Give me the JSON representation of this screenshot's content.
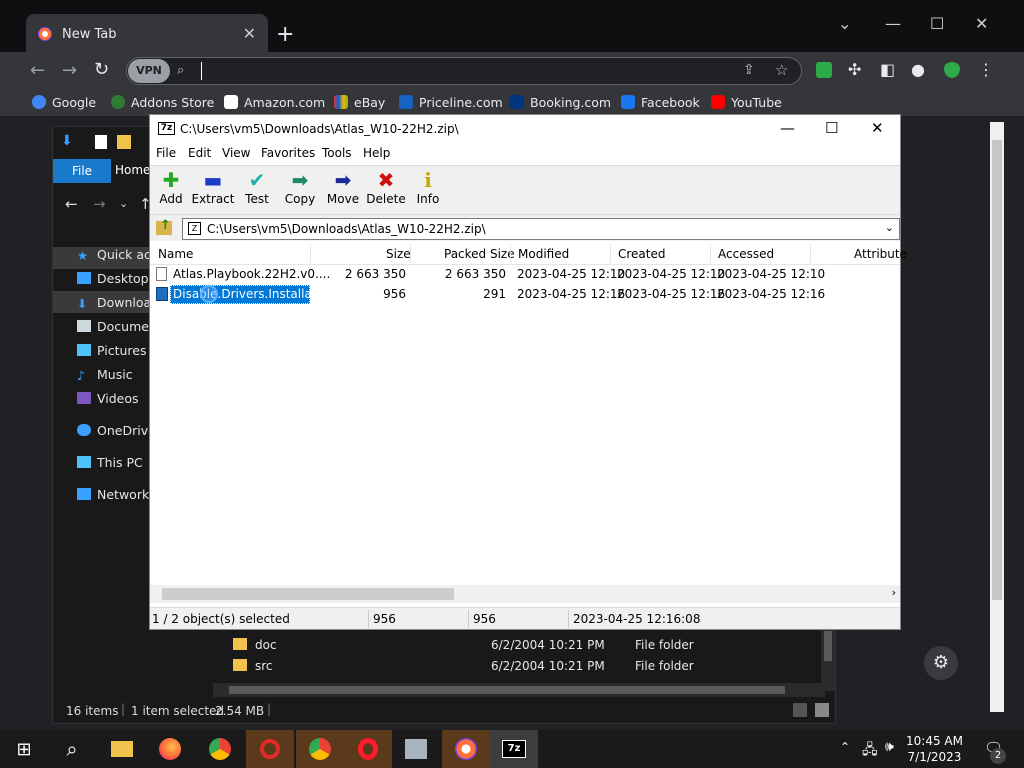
{
  "browser": {
    "tab_title": "New Tab",
    "vpn_label": "VPN",
    "address_value": "",
    "bookmarks": [
      {
        "label": "Google",
        "color": "#4285f4"
      },
      {
        "label": "Addons Store",
        "color": "#2e7d32"
      },
      {
        "label": "Amazon.com",
        "color": "#ffffff"
      },
      {
        "label": "eBay",
        "color": "#e53238"
      },
      {
        "label": "Priceline.com",
        "color": "#1565c0"
      },
      {
        "label": "Booking.com",
        "color": "#003580"
      },
      {
        "label": "Facebook",
        "color": "#1877f2"
      },
      {
        "label": "YouTube",
        "color": "#ff0000"
      }
    ]
  },
  "explorer": {
    "ribbon_file": "File",
    "ribbon_home": "Home",
    "nav": [
      "Quick access",
      "Desktop",
      "Downloads",
      "Documents",
      "Pictures",
      "Music",
      "Videos",
      "OneDrive",
      "This PC",
      "Network"
    ],
    "nav_display": [
      "Quick acc",
      "Desktop",
      "Downloa",
      "Docume",
      "Pictures",
      "Music",
      "Videos",
      "OneDrive",
      "This PC",
      "Network"
    ],
    "rows": [
      {
        "name": "doc",
        "date": "6/2/2004 10:21 PM",
        "type": "File folder"
      },
      {
        "name": "src",
        "date": "6/2/2004 10:21 PM",
        "type": "File folder"
      }
    ],
    "status_items": "16 items",
    "status_selected": "1 item selected",
    "status_size": "2.54 MB"
  },
  "sevenzip": {
    "title": "C:\\Users\\vm5\\Downloads\\Atlas_W10-22H2.zip\\",
    "menu": [
      "File",
      "Edit",
      "View",
      "Favorites",
      "Tools",
      "Help"
    ],
    "tools": [
      {
        "label": "Add",
        "icon": "plus-icon",
        "glyph": "✚",
        "color": "#22aa22"
      },
      {
        "label": "Extract",
        "icon": "minus-icon",
        "glyph": "▬",
        "color": "#1a3cc8"
      },
      {
        "label": "Test",
        "icon": "check-icon",
        "glyph": "✔",
        "color": "#20b2aa"
      },
      {
        "label": "Copy",
        "icon": "copy-arrow-icon",
        "glyph": "➡",
        "color": "#1f8a6a"
      },
      {
        "label": "Move",
        "icon": "move-arrow-icon",
        "glyph": "➡",
        "color": "#1a2c9a"
      },
      {
        "label": "Delete",
        "icon": "delete-x-icon",
        "glyph": "✖",
        "color": "#d01010"
      },
      {
        "label": "Info",
        "icon": "info-icon",
        "glyph": "i",
        "color": "#c8a800"
      }
    ],
    "address": "C:\\Users\\vm5\\Downloads\\Atlas_W10-22H2.zip\\",
    "columns": [
      "Name",
      "Size",
      "Packed Size",
      "Modified",
      "Created",
      "Accessed",
      "Attributes"
    ],
    "columns_display": [
      "Name",
      "Size",
      "Packed Size",
      "Modified",
      "Created",
      "Accessed",
      "Attribute"
    ],
    "files": [
      {
        "name": "Atlas.Playbook.22H2.v0....",
        "size": "2 663 350",
        "packed": "2 663 350",
        "modified": "2023-04-25 12:10",
        "created": "2023-04-25 12:10",
        "accessed": "2023-04-25 12:10"
      },
      {
        "name": "Disable.Drivers.Installati...",
        "size": "956",
        "packed": "291",
        "modified": "2023-04-25 12:16",
        "created": "2023-04-25 12:16",
        "accessed": "2023-04-25 12:16"
      }
    ],
    "status": {
      "selected": "1 / 2 object(s) selected",
      "size": "956",
      "packed": "956",
      "date": "2023-04-25 12:16:08"
    }
  },
  "taskbar": {
    "time": "10:45 AM",
    "date": "7/1/2023",
    "notifications": "2"
  }
}
